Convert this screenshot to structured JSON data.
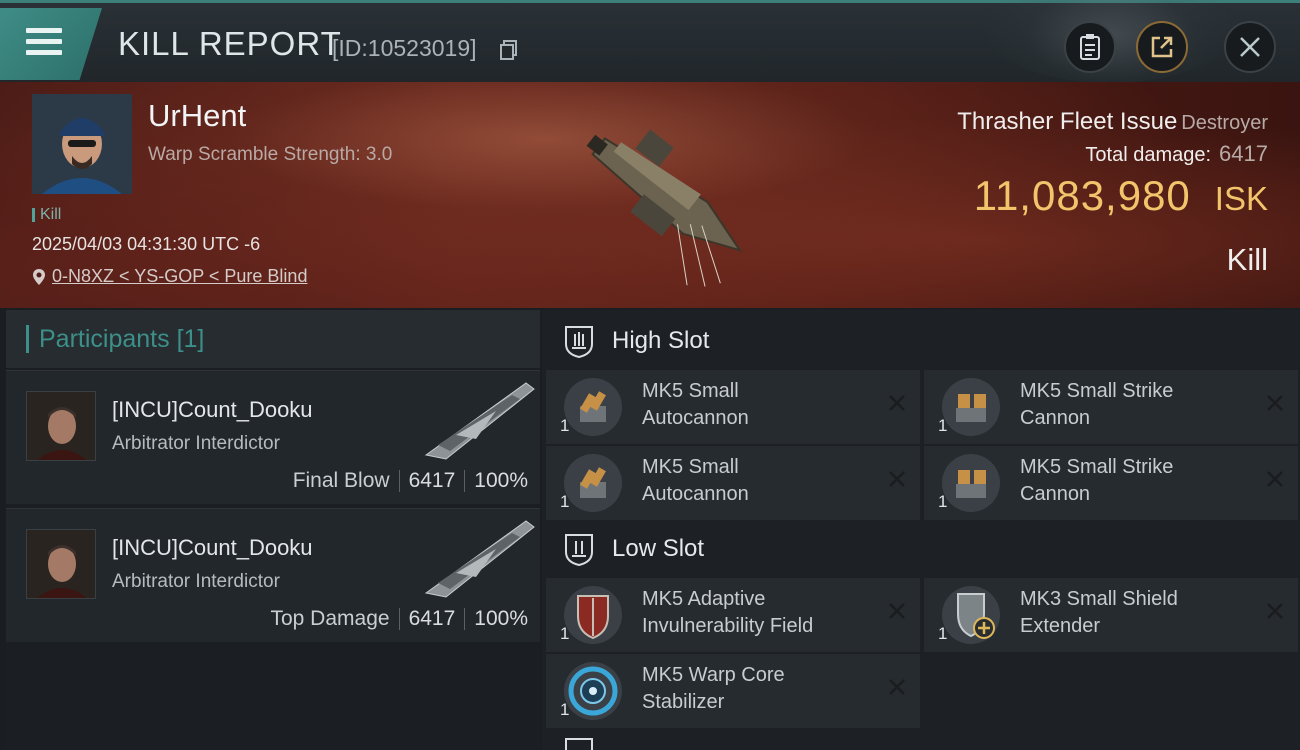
{
  "header": {
    "title": "KILL REPORT",
    "report_id": "[ID:10523019]"
  },
  "victim": {
    "name": "UrHent",
    "warp_scramble": "Warp Scramble Strength: 3.0",
    "tag": "Kill",
    "timestamp": "2025/04/03 04:31:30 UTC -6",
    "location": "0-N8XZ < YS-GOP < Pure Blind",
    "ship_name": "Thrasher Fleet Issue",
    "ship_class": "Destroyer",
    "total_damage_label": "Total damage:",
    "total_damage": "6417",
    "isk_value": "11,083,980",
    "isk_unit": "ISK",
    "result": "Kill"
  },
  "participants": {
    "title": "Participants",
    "count": "[1]",
    "entries": [
      {
        "name": "[INCU]Count_Dooku",
        "ship": "Arbitrator Interdictor",
        "role": "Final Blow",
        "damage": "6417",
        "percent": "100%"
      },
      {
        "name": "[INCU]Count_Dooku",
        "ship": "Arbitrator Interdictor",
        "role": "Top Damage",
        "damage": "6417",
        "percent": "100%"
      }
    ]
  },
  "fitting": {
    "high_slot": {
      "label": "High Slot",
      "modules": [
        {
          "qty": "1",
          "name_line1": "MK5 Small",
          "name_line2": "Autocannon",
          "icon": "autocannon-icon"
        },
        {
          "qty": "1",
          "name_line1": "MK5 Small Strike",
          "name_line2": "Cannon",
          "icon": "strike-cannon-icon"
        },
        {
          "qty": "1",
          "name_line1": "MK5 Small",
          "name_line2": "Autocannon",
          "icon": "autocannon-icon"
        },
        {
          "qty": "1",
          "name_line1": "MK5 Small Strike",
          "name_line2": "Cannon",
          "icon": "strike-cannon-icon"
        }
      ]
    },
    "low_slot": {
      "label": "Low Slot",
      "modules": [
        {
          "qty": "1",
          "name_line1": "MK5 Adaptive",
          "name_line2": "Invulnerability Field",
          "icon": "invulnerability-field-icon"
        },
        {
          "qty": "1",
          "name_line1": "MK3 Small Shield",
          "name_line2": "Extender",
          "icon": "shield-extender-icon"
        },
        {
          "qty": "1",
          "name_line1": "MK5 Warp Core",
          "name_line2": "Stabilizer",
          "icon": "warp-core-stabilizer-icon"
        }
      ]
    }
  },
  "colors": {
    "accent_teal": "#3d8f89",
    "isk_gold": "#f2c46b",
    "hero_red": "#5d221a"
  }
}
